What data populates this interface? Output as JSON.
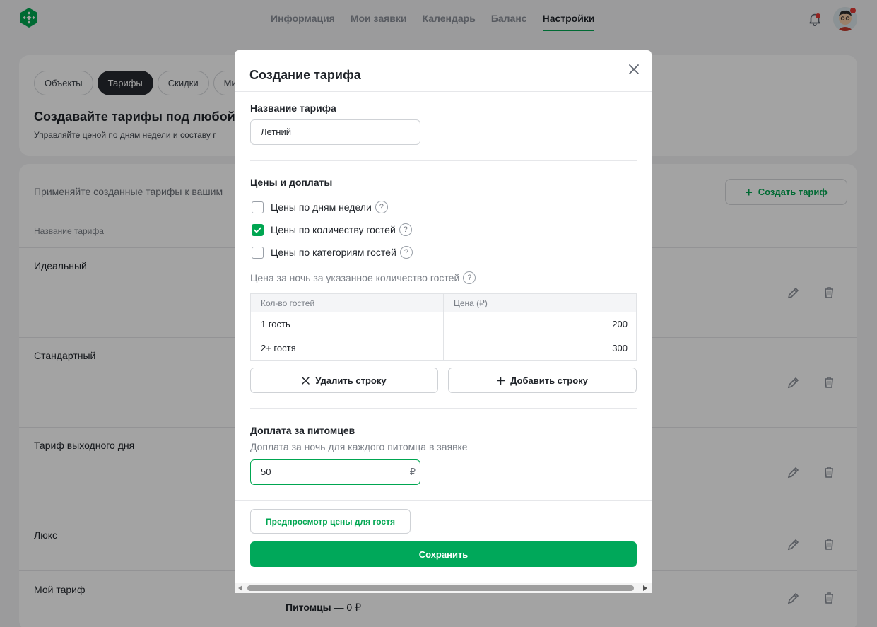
{
  "nav": {
    "items": [
      "Информация",
      "Мои заявки",
      "Календарь",
      "Баланс",
      "Настройки"
    ],
    "active_index": 4
  },
  "colors": {
    "brand": "#00a651",
    "notification": "#e53935"
  },
  "page": {
    "tabs": [
      "Объекты",
      "Тарифы",
      "Скидки",
      "Ми"
    ],
    "active_tab_index": 1,
    "title": "Создавайте тарифы под любой",
    "subtitle": "Управляйте ценой по дням недели и составу г",
    "apply_hint": "Применяйте созданные тарифы к вашим",
    "create_button": "Создать тариф",
    "column_header": "Название тарифа",
    "tariffs": [
      "Идеальный",
      "Стандартный",
      "Тариф выходного дня",
      "Люкс",
      "Мой тариф"
    ],
    "pets_label": "Питомцы",
    "pets_value": "— 0 ₽"
  },
  "modal": {
    "title": "Создание тарифа",
    "name_label": "Название тарифа",
    "name_value": "Летний",
    "prices_title": "Цены и доплаты",
    "options": [
      {
        "label": "Цены по дням недели",
        "checked": false
      },
      {
        "label": "Цены по количеству гостей",
        "checked": true
      },
      {
        "label": "Цены по категориям гостей",
        "checked": false
      }
    ],
    "price_hint": "Цена за ночь за указанное количество гостей",
    "table": {
      "headers": [
        "Кол-во гостей",
        "Цена (₽)"
      ],
      "rows": [
        {
          "guests": "1 гость",
          "price": "200"
        },
        {
          "guests": "2+ гостя",
          "price": "300"
        }
      ]
    },
    "delete_row": "Удалить строку",
    "add_row": "Добавить строку",
    "pets_title": "Доплата за питомцев",
    "pets_hint": "Доплата за ночь для каждого питомца в заявке",
    "pets_value": "50",
    "currency": "₽",
    "preview_button": "Предпросмотр цены для гостя",
    "save_button": "Сохранить"
  }
}
